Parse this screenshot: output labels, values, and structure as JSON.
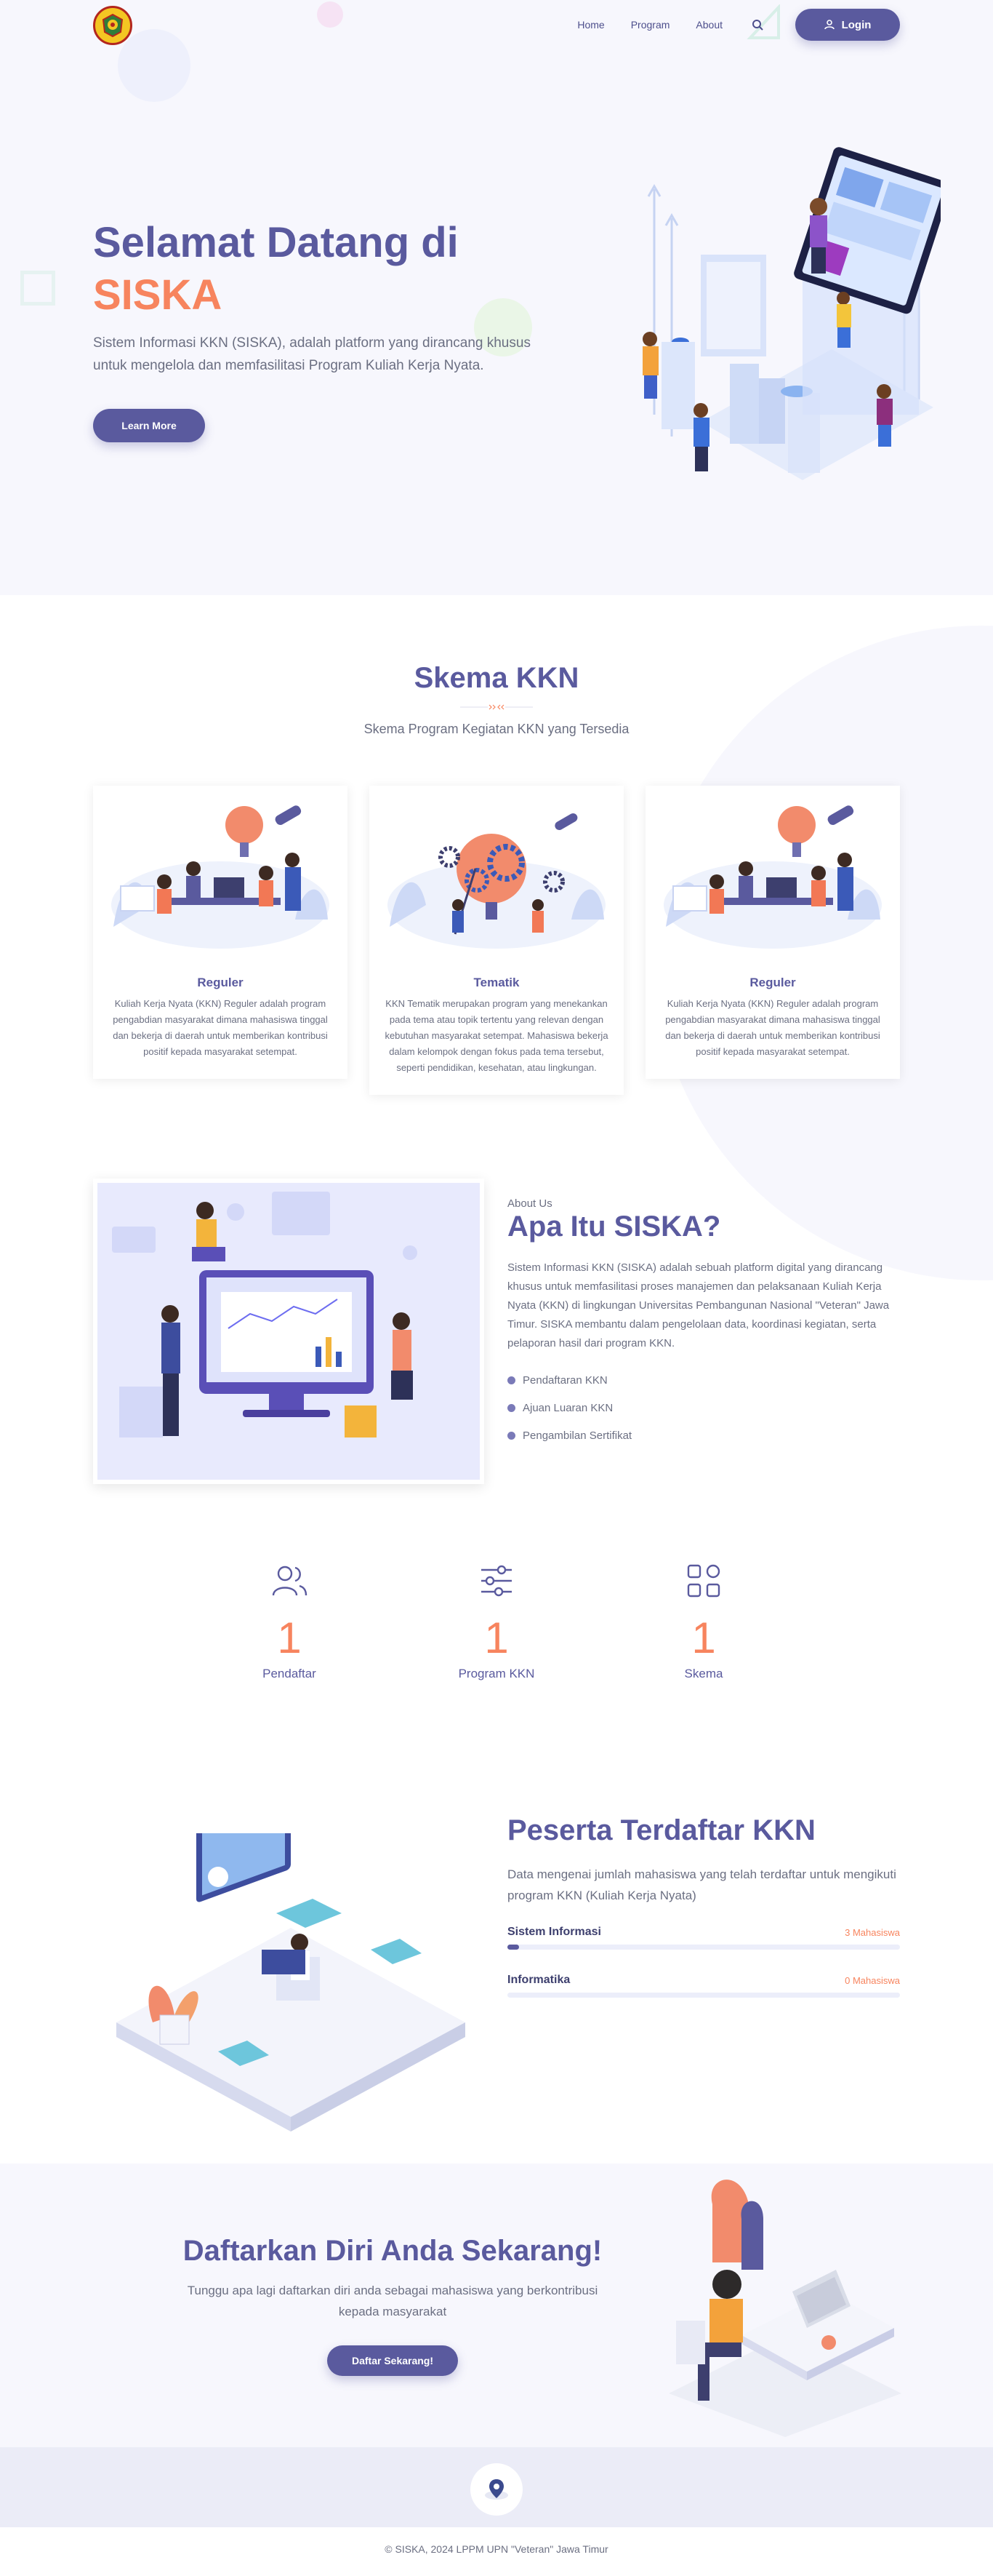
{
  "nav": {
    "items": [
      "Home",
      "Program",
      "About"
    ],
    "login_label": "Login"
  },
  "hero": {
    "title_line1": "Selamat Datang di",
    "title_line2": "SISKA",
    "subtitle": "Sistem Informasi KKN (SISKA), adalah platform yang dirancang khusus untuk mengelola dan memfasilitasi Program Kuliah Kerja Nyata.",
    "button_label": "Learn More"
  },
  "skema": {
    "title": "Skema KKN",
    "subtitle": "Skema Program Kegiatan KKN yang Tersedia",
    "cards": [
      {
        "title": "Reguler",
        "text": "Kuliah Kerja Nyata (KKN) Reguler adalah program pengabdian masyarakat dimana mahasiswa tinggal dan bekerja di daerah untuk memberikan kontribusi positif kepada masyarakat setempat."
      },
      {
        "title": "Tematik",
        "text": "KKN Tematik merupakan program yang menekankan pada tema atau topik tertentu yang relevan dengan kebutuhan masyarakat setempat. Mahasiswa bekerja dalam kelompok dengan fokus pada tema tersebut, seperti pendidikan, kesehatan, atau lingkungan."
      },
      {
        "title": "Reguler",
        "text": "Kuliah Kerja Nyata (KKN) Reguler adalah program pengabdian masyarakat dimana mahasiswa tinggal dan bekerja di daerah untuk memberikan kontribusi positif kepada masyarakat setempat."
      }
    ]
  },
  "about": {
    "small": "About Us",
    "title": "Apa Itu SISKA?",
    "text": "Sistem Informasi KKN (SISKA) adalah sebuah platform digital yang dirancang khusus untuk memfasilitasi proses manajemen dan pelaksanaan Kuliah Kerja Nyata (KKN) di lingkungan Universitas Pembangunan Nasional \"Veteran\" Jawa Timur. SISKA membantu dalam pengelolaan data, koordinasi kegiatan, serta pelaporan hasil dari program KKN.",
    "list": [
      "Pendaftaran KKN",
      "Ajuan Luaran KKN",
      "Pengambilan Sertifikat"
    ]
  },
  "stats": [
    {
      "icon": "users-icon",
      "value": "1",
      "label": "Pendaftar"
    },
    {
      "icon": "sliders-icon",
      "value": "1",
      "label": "Program KKN"
    },
    {
      "icon": "grid-icon",
      "value": "1",
      "label": "Skema"
    }
  ],
  "peserta": {
    "title": "Peserta Terdaftar KKN",
    "text": "Data mengenai jumlah mahasiswa yang telah terdaftar untuk mengikuti program KKN (Kuliah Kerja Nyata)",
    "programs": [
      {
        "name": "Sistem Informasi",
        "count": "3 Mahasiswa",
        "fill": 0.03
      },
      {
        "name": "Informatika",
        "count": "0 Mahasiswa",
        "fill": 0
      }
    ]
  },
  "cta": {
    "title": "Daftarkan Diri Anda Sekarang!",
    "text": "Tunggu apa lagi daftarkan diri anda sebagai mahasiswa yang berkontribusi kepada masyarakat",
    "button_label": "Daftar Sekarang!"
  },
  "footer": {
    "copyright": "© SISKA, 2024 LPPM UPN \"Veteran\" Jawa Timur"
  },
  "colors": {
    "primary": "#5a5a9e",
    "accent": "#f7845e",
    "hero_bg": "#f7f7fd",
    "footer_bg": "#ebecf7"
  }
}
